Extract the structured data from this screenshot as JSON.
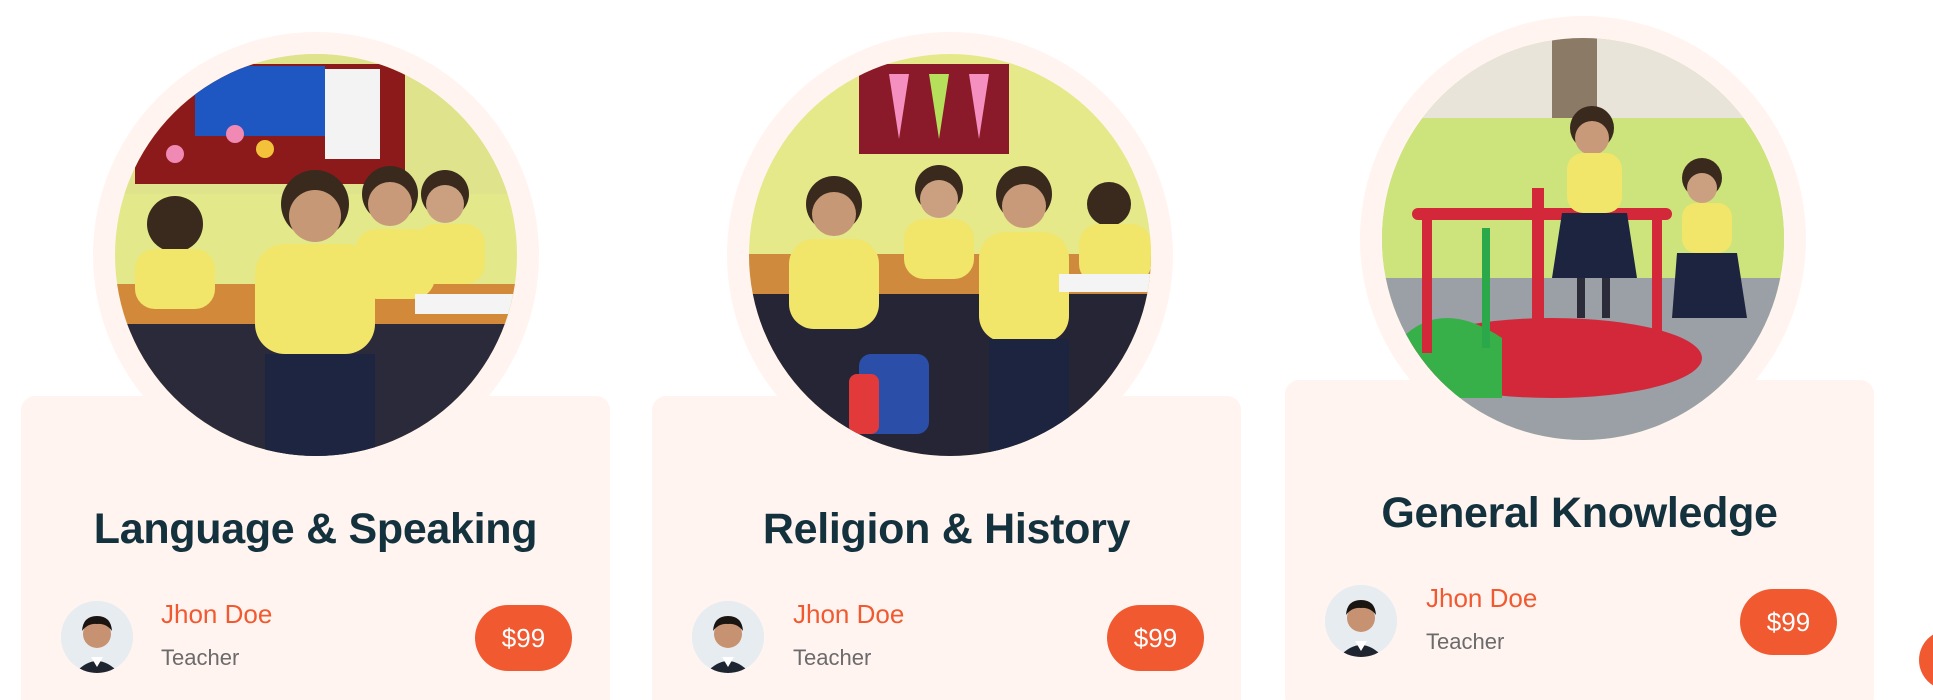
{
  "courses": [
    {
      "title": "Language & Speaking",
      "teacher_name": "Jhon Doe",
      "teacher_role": "Teacher",
      "price": "$99"
    },
    {
      "title": "Religion & History",
      "teacher_name": "Jhon Doe",
      "teacher_role": "Teacher",
      "price": "$99"
    },
    {
      "title": "General Knowledge",
      "teacher_name": "Jhon Doe",
      "teacher_role": "Teacher",
      "price": "$99"
    }
  ],
  "colors": {
    "accent": "#f15a31",
    "card_background": "#fff4f0",
    "title_text": "#13323e",
    "muted_text": "#6b6b6b"
  },
  "icons": {
    "edge_control": "carousel-next-button"
  }
}
